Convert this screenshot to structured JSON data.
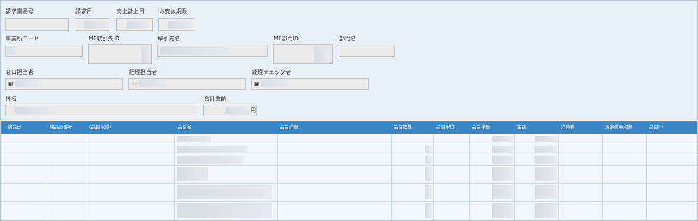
{
  "form": {
    "invoice_no_label": "請求書番号",
    "invoice_date_label": "請求日",
    "sales_date_label": "売上計上日",
    "due_date_label": "お支払期限",
    "office_code_label": "事業所コード",
    "mf_partner_id_label": "MF取引先ID",
    "partner_name_label": "取引先名",
    "mf_dept_id_label": "MF部門ID",
    "dept_name_label": "部門名",
    "contact_label": "窓口担当者",
    "sales_person_label": "経理担当者",
    "check_person_label": "経理チェック者",
    "subject_label": "件名",
    "total_label": "合計金額",
    "total_unit": "円"
  },
  "table": {
    "columns": [
      "納品日",
      "納品書番号",
      "(品目取得)",
      "品目名",
      "品目詳細",
      "品目数量",
      "品目単位",
      "品目単価",
      "金額",
      "消費税",
      "源泉徴収対象",
      "品目ID"
    ]
  },
  "icons": {
    "contact": "person-card-icon",
    "sales_person": "person-icon",
    "check_person": "person-card-icon"
  }
}
